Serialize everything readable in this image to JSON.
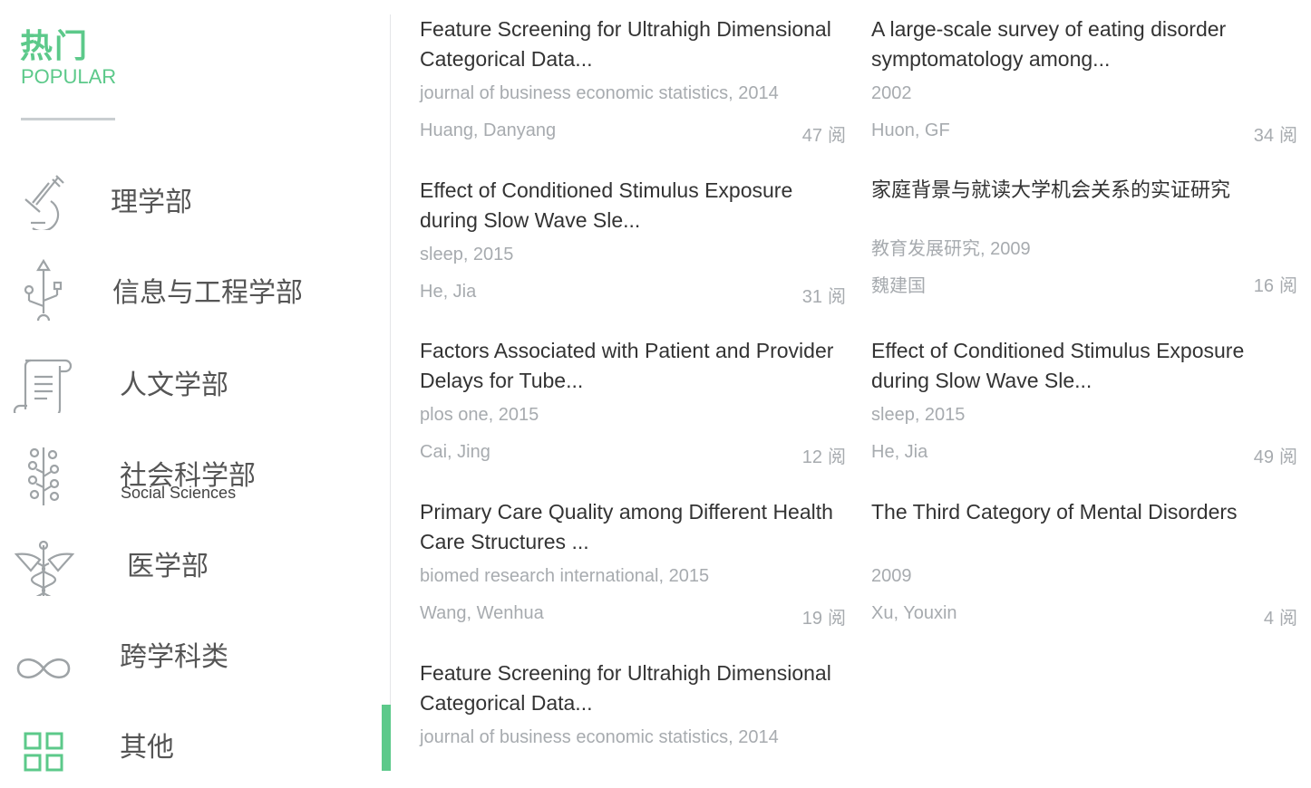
{
  "header": {
    "title_cn": "热门",
    "title_en": "POPULAR"
  },
  "categories": [
    {
      "label": "理学部",
      "icon": "microscope-icon"
    },
    {
      "label": "信息与工程学部",
      "icon": "usb-icon"
    },
    {
      "label": "人文学部",
      "icon": "scroll-icon"
    },
    {
      "label": "社会科学部",
      "sublabel": "Social Sciences",
      "icon": "branch-icon"
    },
    {
      "label": "医学部",
      "icon": "caduceus-icon"
    },
    {
      "label": "跨学科类",
      "icon": "infinity-icon"
    },
    {
      "label": "其他",
      "icon": "grid-icon"
    }
  ],
  "colors": {
    "accent": "#5cc98a",
    "icon_gray": "#9ea3a6",
    "meta_gray": "#a7abaf",
    "text": "#333333"
  },
  "read_suffix": "阅",
  "articles_col1": [
    {
      "title": "Feature Screening for Ultrahigh Dimensional Categorical Data...",
      "source": "journal of business economic statistics, 2014",
      "author": "Huang, Danyang",
      "reads": "47"
    },
    {
      "title": "Effect of Conditioned Stimulus Exposure during Slow Wave Sle...",
      "source": "sleep, 2015",
      "author": "He, Jia",
      "reads": "31"
    },
    {
      "title": "Factors Associated with Patient and Provider Delays for Tube...",
      "source": "plos one, 2015",
      "author": "Cai, Jing",
      "reads": "12"
    },
    {
      "title": "Primary Care Quality among Different Health Care Structures ...",
      "source": "biomed research international, 2015",
      "author": "Wang, Wenhua",
      "reads": "19"
    },
    {
      "title": "Feature Screening for Ultrahigh Dimensional Categorical Data...",
      "source": "journal of business economic statistics, 2014",
      "author": "",
      "reads": ""
    }
  ],
  "articles_col2": [
    {
      "title": "A large-scale survey of eating disorder symptomatology among...",
      "source": "2002",
      "author": "Huon, GF",
      "reads": "34"
    },
    {
      "title": "家庭背景与就读大学机会关系的实证研究",
      "source": "教育发展研究, 2009",
      "author": "魏建国",
      "reads": "16"
    },
    {
      "title": "Effect of Conditioned Stimulus Exposure during Slow Wave Sle...",
      "source": "sleep, 2015",
      "author": "He, Jia",
      "reads": "49"
    },
    {
      "title": "The Third Category of Mental Disorders",
      "source": "2009",
      "author": "Xu, Youxin",
      "reads": "4"
    }
  ]
}
